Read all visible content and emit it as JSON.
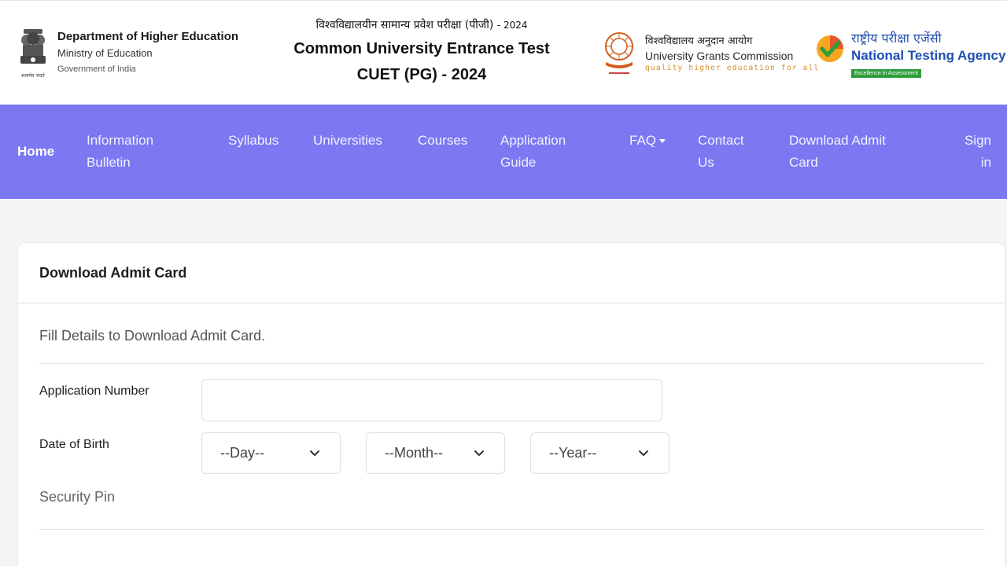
{
  "header": {
    "emblem_caption": "सत्यमेव जयते",
    "dept_line1": "Department of Higher Education",
    "dept_line2": "Ministry of Education",
    "dept_line3": "Government of India",
    "hindi_title": "विश्वविद्यालयीन सामान्य प्रवेश परीक्षा (पीजी)",
    "hindi_year": "- 2024",
    "exam_title": "Common University Entrance Test",
    "exam_subtitle": "CUET (PG) - 2024",
    "ugc_hindi": "विश्वविद्यालय अनुदान आयोग",
    "ugc_name": "University Grants Commission",
    "ugc_tagline": "quality higher education for all",
    "nta_hindi": "राष्ट्रीय परीक्षा एजेंसी",
    "nta_name": "National Testing Agency",
    "nta_badge": "Excellence in Assessment"
  },
  "nav": {
    "home": "Home",
    "info1": "Information",
    "info2": "Bulletin",
    "syllabus": "Syllabus",
    "universities": "Universities",
    "courses": "Courses",
    "guide1": "Application",
    "guide2": "Guide",
    "faq": "FAQ",
    "contact1": "Contact",
    "contact2": "Us",
    "admit1": "Download Admit",
    "admit2": "Card",
    "signin1": "Sign",
    "signin2": "in"
  },
  "card": {
    "title": "Download Admit Card",
    "subtitle": "Fill Details to Download Admit Card.",
    "app_number_label": "Application Number",
    "app_number_value": "",
    "dob_label": "Date of Birth",
    "day_selected": "--Day--",
    "month_selected": "--Month--",
    "year_selected": "--Year--",
    "security_pin_label": "Security Pin"
  },
  "colors": {
    "navbar": "#7b78f2",
    "ugc_accent": "#d98a2a",
    "nta_blue": "#1f4fb3",
    "nta_green": "#2e9d3a"
  },
  "icons": {
    "emblem": "national-emblem-icon",
    "ugc": "ugc-logo-icon",
    "nta": "nta-checkmark-icon",
    "dropdown": "chevron-down-icon",
    "faq_caret": "caret-down-icon"
  }
}
